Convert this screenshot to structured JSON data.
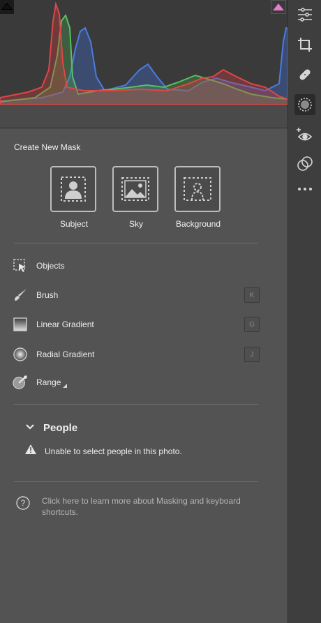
{
  "create_new_mask": {
    "title": "Create New Mask",
    "buttons": [
      {
        "label": "Subject"
      },
      {
        "label": "Sky"
      },
      {
        "label": "Background"
      }
    ]
  },
  "tools": [
    {
      "label": "Objects",
      "shortcut": ""
    },
    {
      "label": "Brush",
      "shortcut": "K"
    },
    {
      "label": "Linear Gradient",
      "shortcut": "G"
    },
    {
      "label": "Radial Gradient",
      "shortcut": "J"
    },
    {
      "label": "Range",
      "shortcut": ""
    }
  ],
  "people": {
    "title": "People",
    "message": "Unable to select people in this photo."
  },
  "help": {
    "text": "Click here to learn more about Masking and keyboard shortcuts."
  },
  "colors": {
    "panel_bg": "#535353",
    "toolbar_bg": "#3e3e3e",
    "histogram_red": "#d23c3c",
    "histogram_green": "#4caf50",
    "histogram_blue": "#3f6fd6",
    "clip_highlight": "#e77cc9"
  },
  "toolbar_icons": [
    "edit-sliders-icon",
    "crop-icon",
    "healing-icon",
    "masking-icon",
    "red-eye-icon",
    "presets-icon",
    "more-icon"
  ]
}
